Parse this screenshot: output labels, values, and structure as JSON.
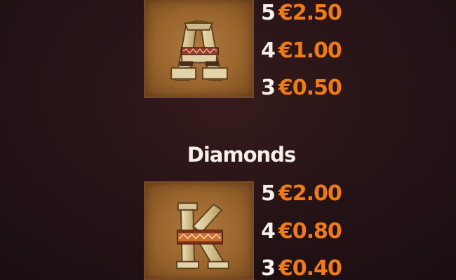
{
  "symbols": [
    {
      "icon": "tribal-letter-a-icon",
      "payouts": [
        {
          "count": "5",
          "value": "€2.50"
        },
        {
          "count": "4",
          "value": "€1.00"
        },
        {
          "count": "3",
          "value": "€0.50"
        }
      ]
    },
    {
      "title": "Diamonds",
      "icon": "tribal-letter-k-icon",
      "payouts": [
        {
          "count": "5",
          "value": "€2.00"
        },
        {
          "count": "4",
          "value": "€0.80"
        },
        {
          "count": "3",
          "value": "€0.40"
        }
      ]
    }
  ],
  "colors": {
    "value": "#f07b14",
    "count": "#f4efe8",
    "tile": "#9a652d"
  }
}
